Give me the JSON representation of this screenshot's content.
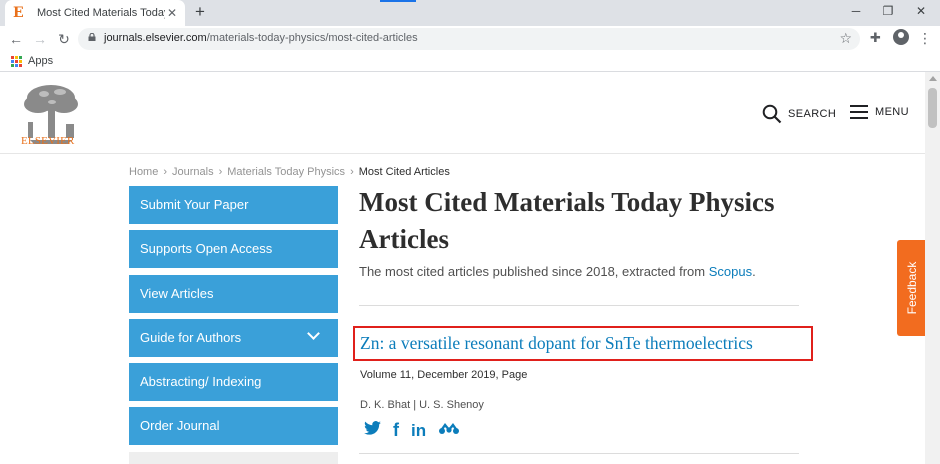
{
  "browser": {
    "tab_favicon": "E",
    "tab_title": "Most Cited Materials Today Physics",
    "tab_close": "✕",
    "new_tab": "+",
    "window_controls": [
      "─",
      "❐",
      "✕"
    ],
    "url_host": "journals.elsevier.com",
    "url_path": "/materials-today-physics/most-cited-articles",
    "bookmarks_apps_label": "Apps",
    "apps_grid_colors": [
      "#ea4335",
      "#fbbc04",
      "#34a853",
      "#4285f4",
      "#ea4335",
      "#fbbc04",
      "#34a853",
      "#4285f4",
      "#ea4335"
    ]
  },
  "header": {
    "logo_text": "ELSEVIER",
    "search_label": "SEARCH",
    "menu_label": "MENU"
  },
  "breadcrumb": {
    "items": [
      "Home",
      "Journals",
      "Materials Today Physics"
    ],
    "current": "Most Cited Articles",
    "separator": "›"
  },
  "sidenav": {
    "items": [
      {
        "label": "Submit Your Paper"
      },
      {
        "label": "Supports Open Access"
      },
      {
        "label": "View Articles"
      },
      {
        "label": "Guide for Authors"
      },
      {
        "label": "Abstracting/ Indexing"
      },
      {
        "label": "Order Journal"
      }
    ],
    "accent_color": "#3aa0d9"
  },
  "main": {
    "title": "Most Cited Materials Today Physics Articles",
    "subtitle_prefix": "The most cited articles published since 2018, extracted from ",
    "subtitle_link": "Scopus",
    "subtitle_suffix": "."
  },
  "article": {
    "title": "Zn: a versatile resonant dopant for SnTe thermoelectrics",
    "meta": "Volume 11, December 2019, Page",
    "authors": "D. K. Bhat | U. S. Shenoy",
    "highlight_color": "#e0201b",
    "link_color": "#0c7dbb"
  },
  "feedback": {
    "label": "Feedback",
    "color": "#f26c1f"
  }
}
